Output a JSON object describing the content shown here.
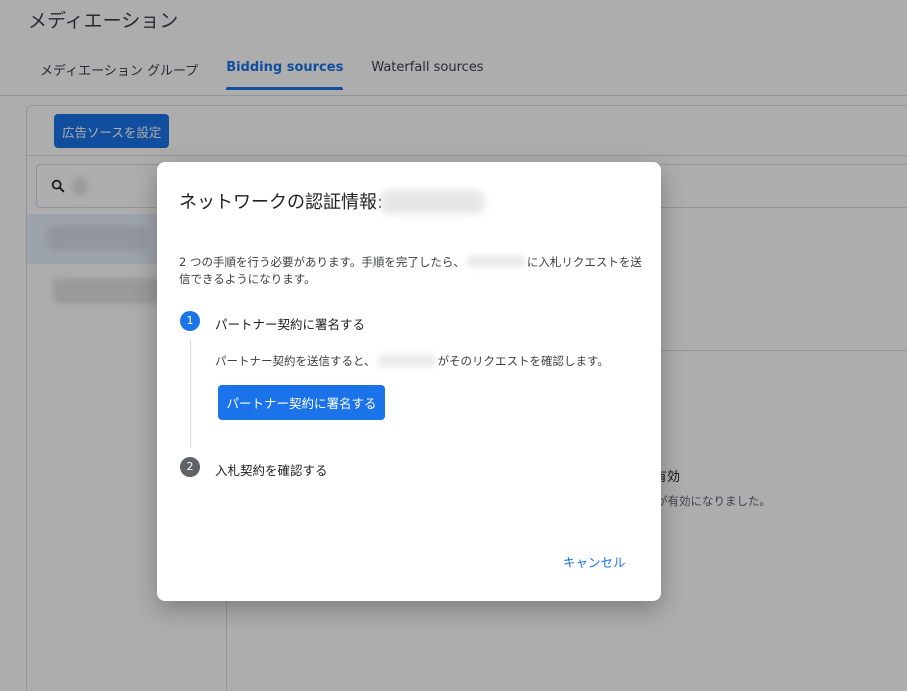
{
  "page": {
    "title": "メディエーション"
  },
  "tabs": [
    {
      "label": "メディエーション グループ",
      "active": false
    },
    {
      "label": "Bidding sources",
      "active": true
    },
    {
      "label": "Waterfall sources",
      "active": false
    }
  ],
  "toolbar": {
    "setup_button": "広告ソースを設定"
  },
  "search": {
    "icon": "search-icon"
  },
  "background_detail": {
    "status": "有効",
    "description": "が有効になりました。"
  },
  "dialog": {
    "title": "ネットワークの認証情報:",
    "intro_before": "2 つの手順を行う必要があります。手順を完了したら、",
    "intro_after": "に入札リクエストを送信できるようになります。",
    "step1": {
      "number": "1",
      "label": "パートナー契約に署名する",
      "desc_before": "パートナー契約を送信すると、",
      "desc_after": "がそのリクエストを確認します。",
      "button": "パートナー契約に署名する"
    },
    "step2": {
      "number": "2",
      "label": "入札契約を確認する"
    },
    "cancel": "キャンセル"
  },
  "colors": {
    "accent": "#1a73e8",
    "step_inactive": "#5f6368",
    "scrim": "rgba(0,0,0,0.32)"
  }
}
